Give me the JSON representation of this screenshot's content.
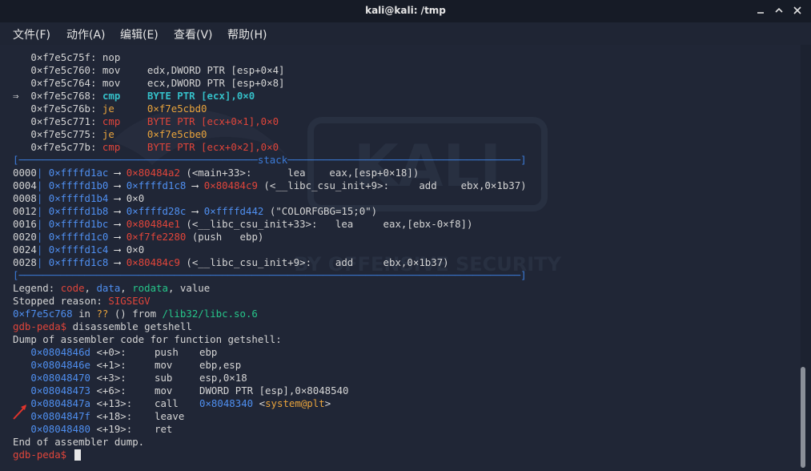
{
  "window": {
    "title": "kali@kali: /tmp"
  },
  "menu": {
    "file": "文件(F)",
    "action": "动作(A)",
    "edit": "编辑(E)",
    "view": "查看(V)",
    "help": "帮助(H)"
  },
  "watermark": {
    "text": "KALI",
    "subtext": "BY OFFENSIVE SECURITY"
  },
  "code": [
    {
      "addr": "0×f7e5c75f:",
      "mnem": "nop",
      "ops": ""
    },
    {
      "addr": "0×f7e5c760:",
      "mnem": "mov",
      "ops": "edx,DWORD PTR [esp+0×4]"
    },
    {
      "addr": "0×f7e5c764:",
      "mnem": "mov",
      "ops": "ecx,DWORD PTR [esp+0×8]"
    },
    {
      "marker": "⇒",
      "addr": "0×f7e5c768:",
      "mnem": "cmp",
      "ops": "BYTE PTR [ecx],0×0"
    },
    {
      "addr": "0×f7e5c76b:",
      "mnem": "je",
      "ops": "0×f7e5cbd0"
    },
    {
      "addr": "0×f7e5c771:",
      "mnem": "cmp",
      "ops": "BYTE PTR [ecx+0×1],0×0"
    },
    {
      "addr": "0×f7e5c775:",
      "mnem": "je",
      "ops": "0×f7e5cbe0"
    },
    {
      "addr": "0×f7e5c77b:",
      "mnem": "cmp",
      "ops": "BYTE PTR [ecx+0×2],0×0"
    }
  ],
  "stack": {
    "open_left": "[",
    "title": "stack",
    "close_right": "]",
    "rows": [
      {
        "off": "0000",
        "p": "0×ffffd1ac",
        "a": "⟶",
        "v": "0×80484a2",
        "rest": " (<main+33>:      lea    eax,[esp+0×18])"
      },
      {
        "off": "0004",
        "p": "0×ffffd1b0",
        "a": "⟶",
        "v": "0×ffffd1c8",
        "a2": "⟶",
        "v2": "0×80484c9",
        "rest": " (<__libc_csu_init+9>:     add    ebx,0×1b37)"
      },
      {
        "off": "0008",
        "p": "0×ffffd1b4",
        "a": "⟶",
        "v": "0×0"
      },
      {
        "off": "0012",
        "p": "0×ffffd1b8",
        "a": "⟶",
        "v": "0×ffffd28c",
        "a2": "⟶",
        "v2": "0×ffffd442",
        "rest": " (\"COLORFGBG=15;0\")"
      },
      {
        "off": "0016",
        "p": "0×ffffd1bc",
        "a": "⟶",
        "v": "0×80484e1",
        "rest": " (<__libc_csu_init+33>:   lea     eax,[ebx-0×f8])"
      },
      {
        "off": "0020",
        "p": "0×ffffd1c0",
        "a": "⟶",
        "v": "0×f7fe2280",
        "rest": " (push   ebp)"
      },
      {
        "off": "0024",
        "p": "0×ffffd1c4",
        "a": "⟶",
        "v": "0×0"
      },
      {
        "off": "0028",
        "p": "0×ffffd1c8",
        "a": "⟶",
        "v": "0×80484c9",
        "rest": " (<__libc_csu_init+9>:    add     ebx,0×1b37)"
      }
    ]
  },
  "legend": {
    "label": "Legend: ",
    "code": "code",
    "sep1": ", ",
    "data": "data",
    "sep2": ", ",
    "rodata": "rodata",
    "sep3": ", ",
    "value": "value"
  },
  "stop": {
    "label": "Stopped reason: ",
    "reason": "SIGSEGV"
  },
  "loc": {
    "addr": "0×f7e5c768",
    "in": " in ",
    "q": "??",
    "mid": " () from ",
    "lib": "/lib32/libc.so.6"
  },
  "cmd1": {
    "prompt": "gdb-peda$",
    "text": " disassemble getshell"
  },
  "dump_header": "Dump of assembler code for function getshell:",
  "dump": [
    {
      "addr": "0×0804846d",
      "off": " <+0>:",
      "mnem": "push",
      "ops": "ebp"
    },
    {
      "addr": "0×0804846e",
      "off": " <+1>:",
      "mnem": "mov",
      "ops": "ebp,esp"
    },
    {
      "addr": "0×08048470",
      "off": " <+3>:",
      "mnem": "sub",
      "ops": "esp,0×18"
    },
    {
      "addr": "0×08048473",
      "off": " <+6>:",
      "mnem": "mov",
      "ops": "DWORD PTR [esp],0×8048540"
    },
    {
      "addr": "0×0804847a",
      "off": " <+13>:",
      "mnem": "call",
      "ops": "",
      "target": "0×8048340",
      "sym": "<system@plt>"
    },
    {
      "addr": "0×0804847f",
      "off": " <+18>:",
      "mnem": "leave",
      "ops": ""
    },
    {
      "addr": "0×08048480",
      "off": " <+19>:",
      "mnem": "ret",
      "ops": ""
    }
  ],
  "dump_footer": "End of assembler dump.",
  "cmd2": {
    "prompt": "gdb-peda$",
    "text": " "
  },
  "colors": {
    "address": "#4f8ff0",
    "code": "#e0453a",
    "rodata": "#26c68a",
    "symbol": "#e8a33c",
    "current": "#35bfc8",
    "terminal_bg": "#202636"
  }
}
